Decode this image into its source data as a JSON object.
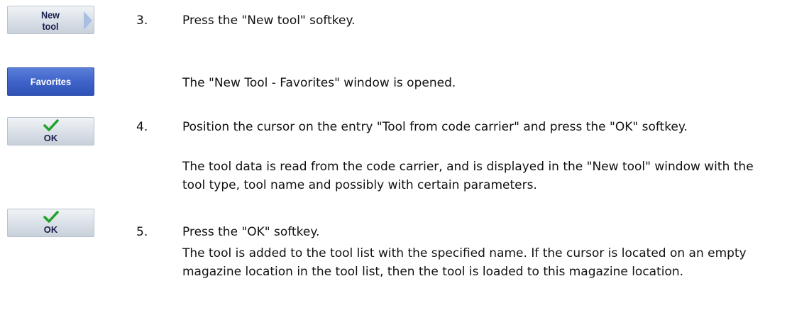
{
  "softkeys": {
    "new_tool": {
      "label_line1": "New",
      "label_line2": "tool"
    },
    "favorites": {
      "label": "Favorites"
    },
    "ok_1": {
      "label": "OK"
    },
    "ok_2": {
      "label": "OK"
    }
  },
  "steps": [
    {
      "number": "3.",
      "text": "Press the \"New tool\" softkey.",
      "result": "The \"New Tool - Favorites\" window is opened."
    },
    {
      "number": "4.",
      "text": "Position the cursor on the entry \"Tool from code carrier\" and press the \"OK\" softkey.",
      "result": "The tool data is read from the code carrier, and is displayed in the \"New tool\" window with the tool type, tool name and possibly with certain parameters."
    },
    {
      "number": "5.",
      "text": "Press the \"OK\" softkey.",
      "result": "The tool is added to the tool list with the specified name. If the cursor is located on an empty magazine location in the tool list, then the tool is loaded to this magazine location."
    }
  ],
  "colors": {
    "softkey_grey": "#dde3ea",
    "softkey_blue": "#3f63c9",
    "checkmark_green": "#1fa12a"
  }
}
